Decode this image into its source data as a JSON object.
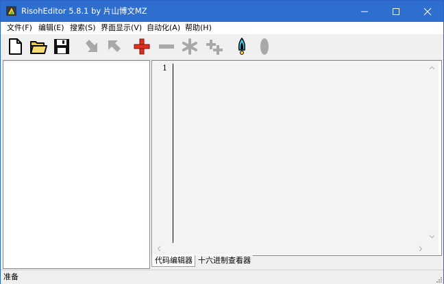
{
  "window": {
    "title": "RisohEditor 5.8.1 by 片山博文MZ",
    "controls": [
      "minimize",
      "maximize",
      "close"
    ]
  },
  "menu": {
    "items": [
      "文件(F)",
      "编辑(E)",
      "搜索(S)",
      "界面显示(V)",
      "自动化(A)",
      "帮助(H)"
    ]
  },
  "toolbar": {
    "buttons": [
      {
        "icon": "new-file-icon",
        "enabled": true
      },
      {
        "icon": "open-folder-icon",
        "enabled": true
      },
      {
        "icon": "save-disk-icon",
        "enabled": true
      },
      {
        "icon": "move-down-icon",
        "enabled": false
      },
      {
        "icon": "move-up-icon",
        "enabled": false
      },
      {
        "icon": "add-plus-icon",
        "enabled": true
      },
      {
        "icon": "delete-minus-icon",
        "enabled": false
      },
      {
        "icon": "edit-asterisk-icon",
        "enabled": false
      },
      {
        "icon": "clone-icon",
        "enabled": false
      },
      {
        "icon": "compile-rocket-icon",
        "enabled": true
      },
      {
        "icon": "test-oval-icon",
        "enabled": false
      }
    ]
  },
  "editor": {
    "line_numbers": [
      "1"
    ],
    "content": ""
  },
  "tabs": {
    "items": [
      "代码编辑器",
      "十六进制查看器"
    ],
    "active": 0
  },
  "status": {
    "text": "准备"
  },
  "colors": {
    "titlebar": "#2e6ecf",
    "accent_red": "#e0301e",
    "disabled_gray": "#a8a8a8"
  }
}
